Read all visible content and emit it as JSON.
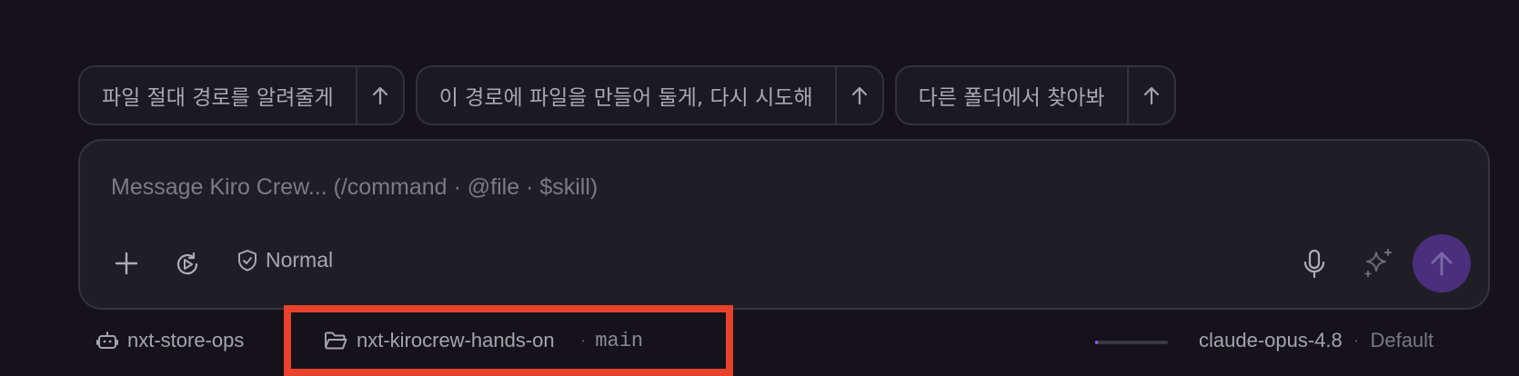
{
  "suggestions": [
    {
      "label": "파일 절대 경로를 알려줄게",
      "send_icon": "arrow-up-icon"
    },
    {
      "label": "이 경로에 파일을 만들어 둘게, 다시 시도해",
      "send_icon": "arrow-up-icon"
    },
    {
      "label": "다른 폴더에서 찾아봐",
      "send_icon": "arrow-up-icon"
    }
  ],
  "composer": {
    "placeholder": "Message Kiro Crew... (/command · @file · $skill)",
    "value": "",
    "mode_label": "Normal",
    "tools": [
      "plus-icon",
      "history-icon",
      "shield-icon",
      "microphone-icon",
      "sparkle-icon",
      "arrow-up-icon"
    ]
  },
  "status_bar": {
    "agent": "nxt-store-ops",
    "workspace": "nxt-kirocrew-hands-on",
    "separator": "·",
    "branch": "main",
    "context_usage_fraction": 0.04,
    "model": "claude-opus-4.8",
    "profile": "Default"
  },
  "colors": {
    "background": "#151319",
    "composer_bg": "#201e25",
    "send_button": "#4a2f7d",
    "highlight_border": "#e8412c",
    "progress_accent": "#8b5cf6"
  }
}
